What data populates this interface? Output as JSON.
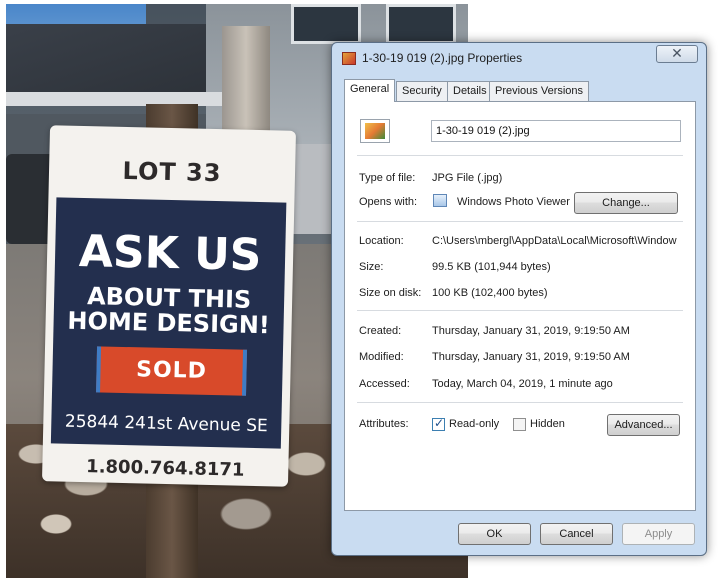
{
  "photo": {
    "sign": {
      "lot": "LOT 33",
      "headline": "ASK US",
      "subheadline_line1": "ABOUT THIS",
      "subheadline_line2": "HOME DESIGN!",
      "badge": "SOLD",
      "address": "25844 241st Avenue SE",
      "phone": "1.800.764.8171"
    }
  },
  "dialog": {
    "title": "1-30-19 019 (2).jpg Properties",
    "close_label": "✕",
    "tabs": [
      {
        "label": "General",
        "active": true
      },
      {
        "label": "Security",
        "active": false
      },
      {
        "label": "Details",
        "active": false
      },
      {
        "label": "Previous Versions",
        "active": false
      }
    ],
    "general": {
      "filename": "1-30-19 019 (2).jpg",
      "type_label": "Type of file:",
      "type_value": "JPG File (.jpg)",
      "opens_label": "Opens with:",
      "opens_value": "Windows Photo Viewer",
      "change_button": "Change...",
      "location_label": "Location:",
      "location_value": "C:\\Users\\mbergl\\AppData\\Local\\Microsoft\\Window",
      "size_label": "Size:",
      "size_value": "99.5 KB (101,944 bytes)",
      "size_on_disk_label": "Size on disk:",
      "size_on_disk_value": "100 KB (102,400 bytes)",
      "created_label": "Created:",
      "created_value": "Thursday, January 31, 2019, 9:19:50 AM",
      "modified_label": "Modified:",
      "modified_value": "Thursday, January 31, 2019, 9:19:50 AM",
      "accessed_label": "Accessed:",
      "accessed_value": "Today, March 04, 2019, 1 minute ago",
      "attributes_label": "Attributes:",
      "readonly_label": "Read-only",
      "readonly_checked": true,
      "hidden_label": "Hidden",
      "hidden_checked": false,
      "advanced_button": "Advanced..."
    },
    "footer": {
      "ok": "OK",
      "cancel": "Cancel",
      "apply": "Apply"
    }
  }
}
